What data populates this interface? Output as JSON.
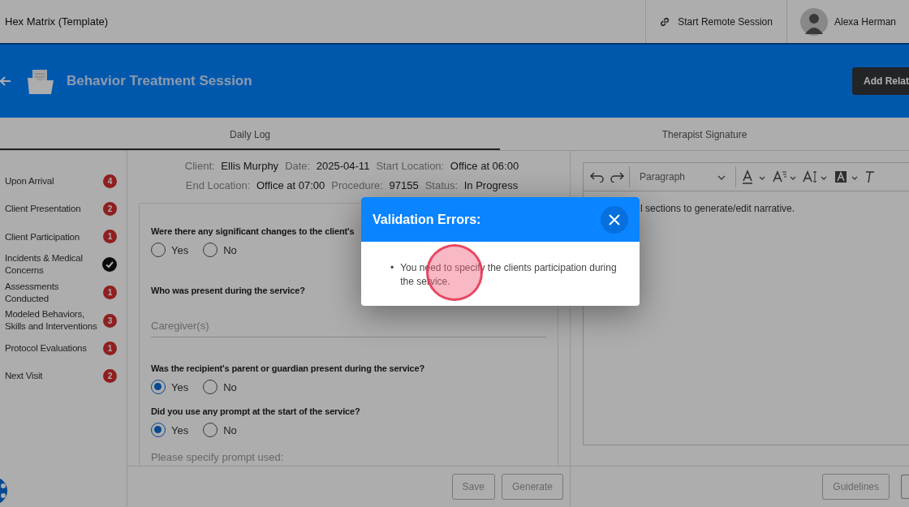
{
  "topbar": {
    "title": "Hex Matrix (Template)",
    "remote_session": "Start Remote Session",
    "user_name": "Alexa Herman"
  },
  "header": {
    "title": "Behavior Treatment Session",
    "action_button": "Add Relat"
  },
  "tabs": [
    {
      "label": "Daily Log",
      "selected": true
    },
    {
      "label": "Therapist Signature",
      "selected": false
    }
  ],
  "sidebar": {
    "items": [
      {
        "label": "Upon Arrival",
        "kind": "count",
        "badge": "4"
      },
      {
        "label": "Client Presentation",
        "kind": "count",
        "badge": "2"
      },
      {
        "label": "Client Participation",
        "kind": "count",
        "badge": "1"
      },
      {
        "label": "Incidents & Medical Concerns",
        "kind": "done"
      },
      {
        "label": "Assessments Conducted",
        "kind": "count",
        "badge": "1"
      },
      {
        "label": "Modeled Behaviors, Skills and Interventions",
        "kind": "count",
        "badge": "3"
      },
      {
        "label": "Protocol Evaluations",
        "kind": "count",
        "badge": "1"
      },
      {
        "label": "Next Visit",
        "kind": "count",
        "badge": "2"
      }
    ]
  },
  "session_info": [
    [
      {
        "label": "Client:",
        "value": "Ellis Murphy"
      },
      {
        "label": "Date:",
        "value": "2025-04-11"
      },
      {
        "label": "Start Location:",
        "value": "Office at 06:00"
      }
    ],
    [
      {
        "label": "End Location:",
        "value": "Office at 07:00"
      },
      {
        "label": "Procedure:",
        "value": "97155"
      },
      {
        "label": "Status:",
        "value": "In Progress"
      }
    ]
  ],
  "questions": [
    {
      "kind": "radio",
      "label": "Were there any significant changes to the client's",
      "options": [
        {
          "label": "Yes",
          "selected": false
        },
        {
          "label": "No",
          "selected": false
        }
      ]
    },
    {
      "kind": "field",
      "label": "Who was present during the service?",
      "placeholder": "Caregiver(s)"
    },
    {
      "kind": "radio",
      "label": "Was the recipient's parent or guardian present during the service?",
      "options": [
        {
          "label": "Yes",
          "selected": true
        },
        {
          "label": "No",
          "selected": false
        }
      ]
    },
    {
      "kind": "radio",
      "label": "Did you use any prompt at the start of the service?",
      "options": [
        {
          "label": "Yes",
          "selected": true
        },
        {
          "label": "No",
          "selected": false
        }
      ]
    },
    {
      "kind": "field",
      "placeholder": "Please specify prompt used:"
    }
  ],
  "form_buttons": [
    {
      "label": "Save",
      "disabled": true
    },
    {
      "label": "Generate",
      "disabled": true
    }
  ],
  "editor": {
    "block_format": "Paragraph",
    "text": "l sections to generate/edit narrative."
  },
  "editor_buttons": [
    {
      "label": "Guidelines",
      "disabled": true
    }
  ],
  "modal": {
    "title": "Validation Errors:",
    "errors": [
      {
        "marker": "•",
        "text": "You need to specify the clients participation during the service."
      }
    ]
  }
}
